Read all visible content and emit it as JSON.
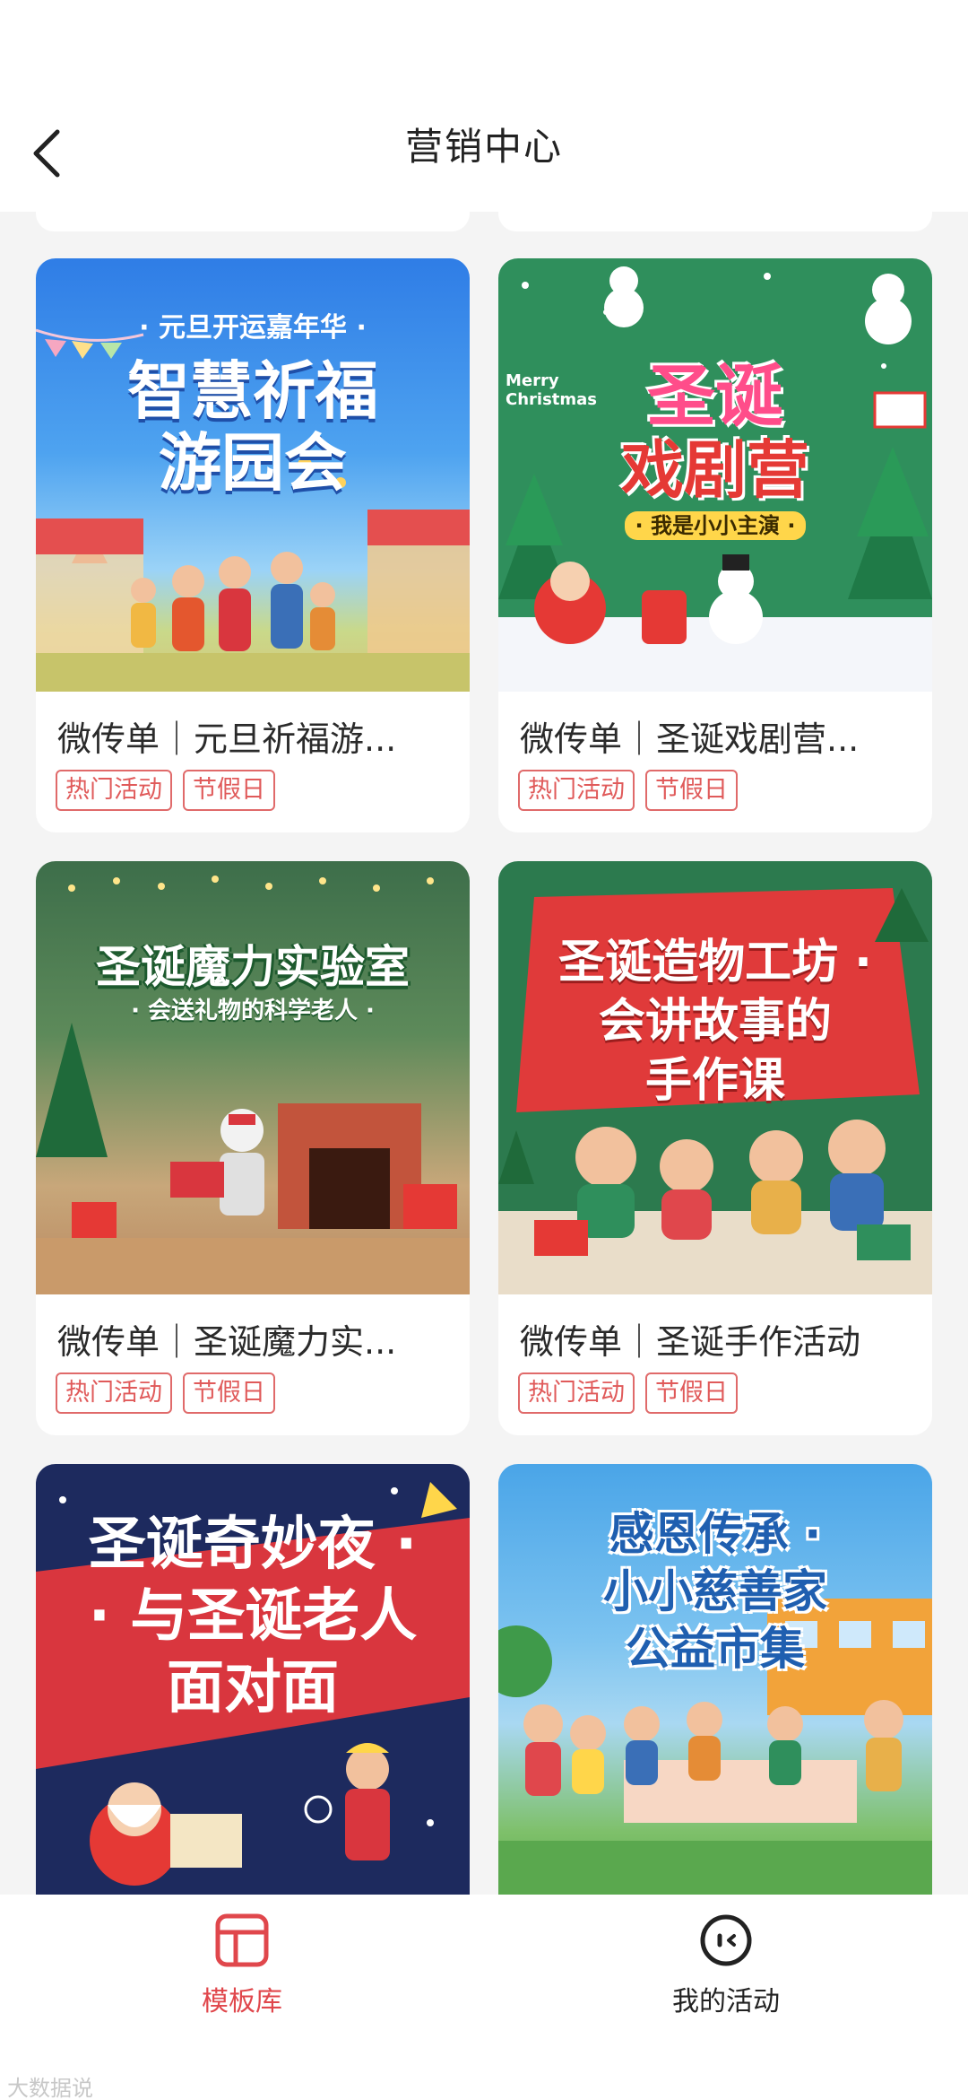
{
  "header": {
    "title": "营销中心"
  },
  "cards": [
    {
      "title": "微传单｜元旦祈福游...",
      "tags": [
        "热门活动",
        "节假日"
      ],
      "art": {
        "subtitle": "· 元旦开运嘉年华 ·",
        "line1": "智慧祈福",
        "line2": "游园会"
      }
    },
    {
      "title": "微传单｜圣诞戏剧营...",
      "tags": [
        "热门活动",
        "节假日"
      ],
      "art": {
        "line1": "圣诞",
        "line2": "戏剧营",
        "sub": "· 我是小小主演 ·",
        "corner": "Merry Christmas"
      }
    },
    {
      "title": "微传单｜圣诞魔力实...",
      "tags": [
        "热门活动",
        "节假日"
      ],
      "art": {
        "line1": "圣诞魔力实验室",
        "sub": "· 会送礼物的科学老人 ·"
      }
    },
    {
      "title": "微传单｜圣诞手作活动",
      "tags": [
        "热门活动",
        "节假日"
      ],
      "art": {
        "line1": "圣诞造物工坊 ·",
        "line2": "会讲故事的",
        "line3": "手作课"
      }
    },
    {
      "art": {
        "line1": "圣诞奇妙夜 ·",
        "line2": "· 与圣诞老人",
        "line3": "面对面"
      }
    },
    {
      "art": {
        "line1": "感恩传承 ·",
        "line2": "小小慈善家",
        "line3": "公益市集"
      }
    }
  ],
  "tabbar": {
    "items": [
      {
        "label": "模板库",
        "icon": "template-icon",
        "active": true
      },
      {
        "label": "我的活动",
        "icon": "activity-face-icon",
        "active": false
      }
    ],
    "active_color": "#e0474c"
  },
  "watermark": "大数据说"
}
